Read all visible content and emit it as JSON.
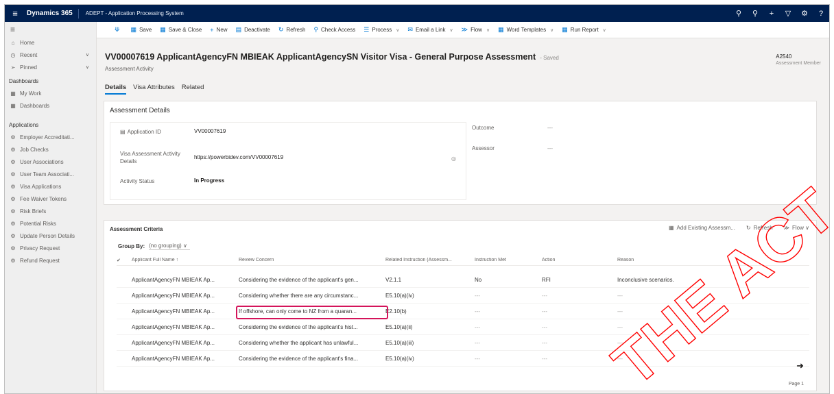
{
  "app": {
    "brand": "Dynamics 365",
    "name": "ADEPT - Application Processing System",
    "colors": {
      "topbar": "#002050",
      "accent": "#0078d4",
      "highlight": "#d4145a",
      "watermark": "#ff0000"
    }
  },
  "topbar_icons": [
    "search-icon",
    "lightbulb-icon",
    "plus-icon",
    "filter-icon",
    "gear-icon",
    "help-icon"
  ],
  "sidebar": {
    "items_top": [
      {
        "icon": "home-icon",
        "label": "Home",
        "chevron": false
      },
      {
        "icon": "clock-icon",
        "label": "Recent",
        "chevron": true
      },
      {
        "icon": "pin-icon",
        "label": "Pinned",
        "chevron": true
      }
    ],
    "dashboards_heading": "Dashboards",
    "dashboard_items": [
      {
        "icon": "grid-icon",
        "label": "My Work"
      },
      {
        "icon": "grid-icon",
        "label": "Dashboards"
      }
    ],
    "applications_heading": "Applications",
    "application_items": [
      "Employer Accreditati...",
      "Job Checks",
      "User Associations",
      "User Team Associati...",
      "Visa Applications",
      "Fee Waiver Tokens",
      "Risk Briefs",
      "Potential Risks",
      "Update Person Details",
      "Privacy Request",
      "Refund Request"
    ]
  },
  "command_bar": {
    "back": "back-icon",
    "buttons": [
      {
        "icon": "save-icon",
        "label": "Save",
        "dropdown": false
      },
      {
        "icon": "save-close-icon",
        "label": "Save & Close",
        "dropdown": false
      },
      {
        "icon": "plus-icon",
        "label": "New",
        "dropdown": false
      },
      {
        "icon": "deactivate-icon",
        "label": "Deactivate",
        "dropdown": false
      },
      {
        "icon": "refresh-icon",
        "label": "Refresh",
        "dropdown": false
      },
      {
        "icon": "check-access-icon",
        "label": "Check Access",
        "dropdown": false
      },
      {
        "icon": "process-icon",
        "label": "Process",
        "dropdown": true
      },
      {
        "icon": "email-link-icon",
        "label": "Email a Link",
        "dropdown": true
      },
      {
        "icon": "flow-icon",
        "label": "Flow",
        "dropdown": true
      },
      {
        "icon": "word-templates-icon",
        "label": "Word Templates",
        "dropdown": true
      },
      {
        "icon": "run-report-icon",
        "label": "Run Report",
        "dropdown": true
      }
    ]
  },
  "header": {
    "title": "VV00007619 ApplicantAgencyFN MBIEAK ApplicantAgencySN Visitor Visa - General Purpose Assessment",
    "saved": "- Saved",
    "entity": "Assessment Activity",
    "right_value": "A2540",
    "right_label": "Assessment Member",
    "tabs": [
      "Details",
      "Visa Attributes",
      "Related"
    ]
  },
  "details": {
    "section_title": "Assessment Details",
    "application_id_label": "Application ID",
    "application_id_value": "VV00007619",
    "visa_link_label": "Visa Assessment Activity Details",
    "visa_link_value": "https://powerbidev.com/VV00007619",
    "activity_status_label": "Activity Status",
    "activity_status_value": "In Progress",
    "outcome_label": "Outcome",
    "outcome_value": "---",
    "assessor_label": "Assessor",
    "assessor_value": "---"
  },
  "criteria": {
    "title": "Assessment Criteria",
    "commands": [
      {
        "icon": "add-existing-icon",
        "label": "Add Existing Assessm..."
      },
      {
        "icon": "refresh-icon",
        "label": "Refresh"
      },
      {
        "icon": "flow-icon",
        "label": "Flow"
      }
    ],
    "group_by_label": "Group By:",
    "group_by_value": "(no grouping)",
    "columns": [
      "Applicant Full Name ↑",
      "Review Concern",
      "Related Instruction (Assessm...",
      "Instruction Met",
      "Action",
      "Reason"
    ],
    "rows": [
      {
        "name": "ApplicantAgencyFN MBIEAK Ap...",
        "concern": "Considering the evidence of the applicant's gen...",
        "instruction": "V2.1.1",
        "met": "No",
        "action": "RFI",
        "reason": "Inconclusive scenarios."
      },
      {
        "name": "ApplicantAgencyFN MBIEAK Ap...",
        "concern": "Considering whether there are any circumstanc...",
        "instruction": "E5.10(a)(iv)",
        "met": "---",
        "action": "---",
        "reason": "---"
      },
      {
        "name": "ApplicantAgencyFN MBIEAK Ap...",
        "concern": "If offshore, can only come to NZ from a quaran...",
        "instruction": "E2.10(b)",
        "met": "---",
        "action": "---",
        "reason": "---"
      },
      {
        "name": "ApplicantAgencyFN MBIEAK Ap...",
        "concern": "Considering the evidence of the applicant's hist...",
        "instruction": "E5.10(a)(ii)",
        "met": "---",
        "action": "---",
        "reason": "---"
      },
      {
        "name": "ApplicantAgencyFN MBIEAK Ap...",
        "concern": "Considering whether the applicant has unlawful...",
        "instruction": "E5.10(a)(iii)",
        "met": "---",
        "action": "---",
        "reason": "---"
      },
      {
        "name": "ApplicantAgencyFN MBIEAK Ap...",
        "concern": "Considering the evidence of the applicant's fina...",
        "instruction": "E5.10(a)(iv)",
        "met": "---",
        "action": "---",
        "reason": "---"
      }
    ],
    "pager": "Page 1"
  },
  "watermark": {
    "text": "THE ACT"
  }
}
